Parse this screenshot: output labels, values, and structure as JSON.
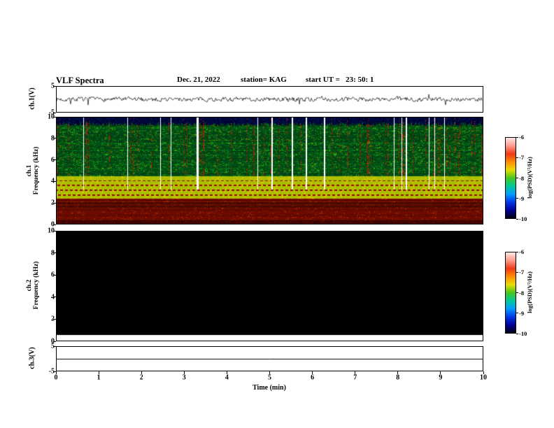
{
  "header": {
    "title": "VLF Spectra",
    "date": "Dec. 21, 2022",
    "station": "station= KAG",
    "start_ut": "start UT =   23: 50: 1"
  },
  "xaxis": {
    "label": "Time (min)",
    "ticks": [
      "0",
      "1",
      "2",
      "3",
      "4",
      "5",
      "6",
      "7",
      "8",
      "9",
      "10"
    ],
    "range": [
      0,
      10
    ]
  },
  "colorbar": {
    "label": "log(PSD)(V²/Hz)",
    "ticks": [
      "-6",
      "-7",
      "-8",
      "-9",
      "-10"
    ],
    "range": [
      -10,
      -6
    ],
    "stops_top_to_bottom": [
      "#ffe6e6",
      "#ff9a8a",
      "#f03818",
      "#ff8c00",
      "#e8dc00",
      "#46c81e",
      "#00c896",
      "#009cff",
      "#0038e6",
      "#000096",
      "#000010"
    ]
  },
  "chart_data": [
    {
      "type": "line",
      "panel": "ch.1 waveform",
      "ylabel": "ch.1(V)",
      "ylim": [
        -5,
        5
      ],
      "yticks": [
        "5",
        "-5"
      ],
      "xlim": [
        0,
        10
      ],
      "series": [
        {
          "name": "ch.1 voltage (V)",
          "summary": "continuous broadband noise centred on 0 V, amplitude mostly within ±1 V with frequent narrow spikes to about ±2 V across the whole 10-minute record"
        }
      ]
    },
    {
      "type": "heatmap",
      "panel": "ch.1 spectrogram",
      "channel": "ch.1",
      "ylabel": "Frequency (kHz)",
      "ylim": [
        0,
        10
      ],
      "yticks": [
        "10",
        "8",
        "6",
        "4",
        "2",
        "0"
      ],
      "xlim": [
        0,
        10
      ],
      "zlabel": "log(PSD)(V²/Hz)",
      "zlim": [
        -10,
        -6
      ],
      "features": [
        {
          "f_kHz": [
            9.4,
            10
          ],
          "appearance": "dark navy/black band along the top edge with jagged green spikes reaching down from it"
        },
        {
          "f_kHz": [
            4.5,
            9.4
          ],
          "appearance": "dense mottled green-yellow background (PSD ≈ -8) crossed by many thin vertical red sferic streaks and scattered narrow white vertical data gaps"
        },
        {
          "f_kHz": [
            2.4,
            4.5
          ],
          "appearance": "yellow-green region with regularly spaced rows of dashed dark-red horizontal harmonic lines"
        },
        {
          "f_kHz": [
            0.3,
            2.4
          ],
          "appearance": "intense red-orange horizontally streaked noise (PSD ≈ -6 to -7)"
        },
        {
          "f_kHz": [
            0,
            0.3
          ],
          "appearance": "very dark red baseline band"
        }
      ]
    },
    {
      "type": "heatmap",
      "panel": "ch.2 spectrogram",
      "channel": "ch.2",
      "ylabel": "Frequency (kHz)",
      "ylim": [
        0,
        10
      ],
      "yticks": [
        "10",
        "8",
        "6",
        "4",
        "2",
        "0"
      ],
      "xlim": [
        0,
        10
      ],
      "zlabel": "log(PSD)(V²/Hz)",
      "zlim": [
        -10,
        -6
      ],
      "features": [
        {
          "f_kHz": [
            0,
            10
          ],
          "appearance": "no data — uniform black panel"
        }
      ]
    },
    {
      "type": "line",
      "panel": "ch.3 waveform",
      "ylabel": "ch.3(V)",
      "ylim": [
        -5,
        5
      ],
      "yticks": [
        "5",
        "-5"
      ],
      "xlim": [
        0,
        10
      ],
      "series": [
        {
          "name": "ch.3 voltage (V)",
          "summary": "flat line at 0 V for the entire record"
        }
      ]
    }
  ]
}
